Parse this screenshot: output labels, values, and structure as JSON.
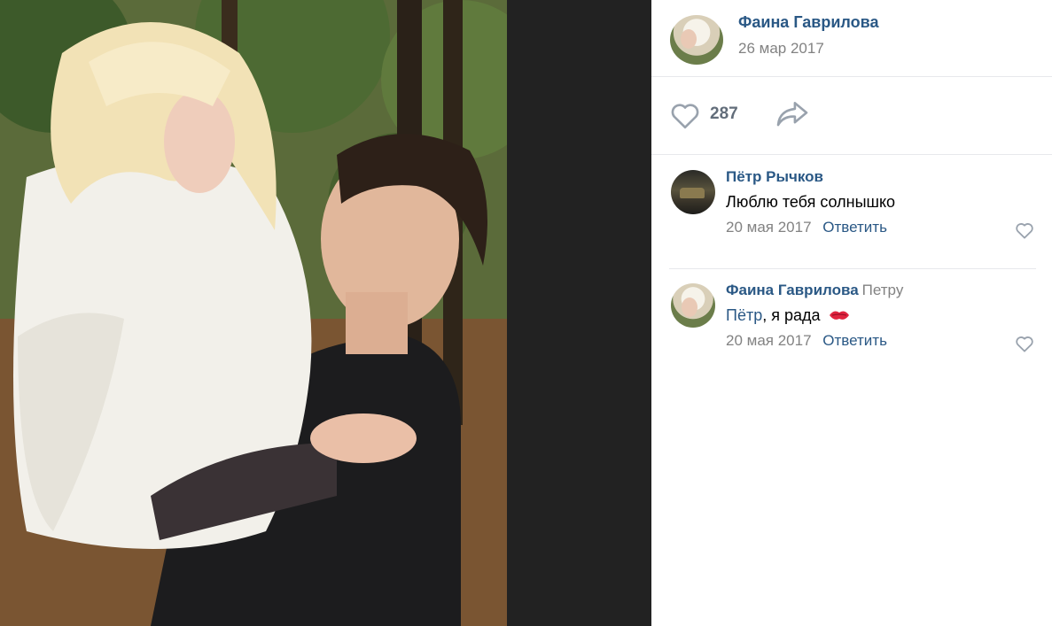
{
  "post": {
    "author": "Фаина Гаврилова",
    "date": "26 мар 2017",
    "likes": "287"
  },
  "comments": [
    {
      "author": "Пётр Рычков",
      "reply_to": "",
      "mention": "",
      "text": "Люблю тебя солнышко",
      "date": "20 мая 2017",
      "reply_label": "Ответить"
    },
    {
      "author": "Фаина Гаврилова",
      "reply_to": "Петру",
      "mention": "Пётр",
      "text": ", я рада",
      "date": "20 мая 2017",
      "reply_label": "Ответить"
    }
  ],
  "colors": {
    "link": "#2a5885",
    "muted": "#828282",
    "icon": "#99a2ad",
    "divider": "#e7e8ec",
    "photo_backdrop": "#222222"
  },
  "icons": {
    "like": "heart-outline-icon",
    "share": "share-arrow-icon",
    "emoji": "kiss-mark-icon"
  }
}
